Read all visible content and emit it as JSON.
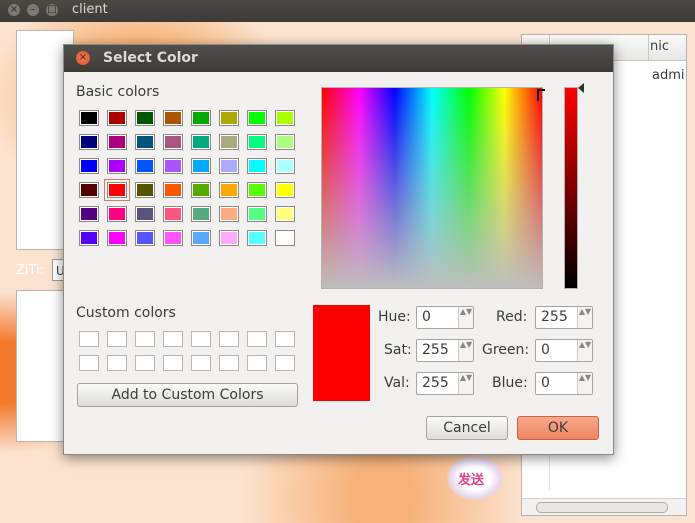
{
  "window": {
    "title": "client",
    "close_glyph": "×",
    "min_glyph": "–",
    "max_glyph": "□"
  },
  "main": {
    "ziti_label": "ZiTi:",
    "ziti_value": "U",
    "users_header": "nic",
    "users_cell": "admi",
    "send_label": "发送"
  },
  "dialog": {
    "title": "Select Color",
    "close_glyph": "×",
    "basic_colors_label": "Basic colors",
    "custom_colors_label": "Custom colors",
    "add_custom_label": "Add to Custom Colors",
    "cancel_label": "Cancel",
    "ok_label": "OK",
    "hue_label": "Hue:",
    "hue_value": "0",
    "sat_label": "Sat:",
    "sat_value": "255",
    "val_label": "Val:",
    "val_value": "255",
    "red_label": "Red:",
    "red_value": "255",
    "green_label": "Green:",
    "green_value": "0",
    "blue_label": "Blue:",
    "blue_value": "0",
    "spin_arrows": "▲▼",
    "current_color": "#ff0000",
    "basic_colors": [
      "#000000",
      "#aa0000",
      "#005500",
      "#aa5500",
      "#00aa00",
      "#aaaa00",
      "#00ff00",
      "#aaff00",
      "#00007f",
      "#aa007f",
      "#00557f",
      "#aa557f",
      "#00aa7f",
      "#aaaa7f",
      "#00ff7f",
      "#aaff7f",
      "#0000ff",
      "#aa00ff",
      "#0055ff",
      "#aa55ff",
      "#00aaff",
      "#aaaaff",
      "#00ffff",
      "#aaffff",
      "#550000",
      "#ff0000",
      "#555500",
      "#ff5500",
      "#55aa00",
      "#ffaa00",
      "#55ff00",
      "#ffff00",
      "#55007f",
      "#ff007f",
      "#55557f",
      "#ff557f",
      "#55aa7f",
      "#ffaa7f",
      "#55ff7f",
      "#ffff7f",
      "#5500ff",
      "#ff00ff",
      "#5555ff",
      "#ff55ff",
      "#55aaff",
      "#ffaaff",
      "#55ffff",
      "#ffffff"
    ],
    "selected_swatch": 25
  }
}
